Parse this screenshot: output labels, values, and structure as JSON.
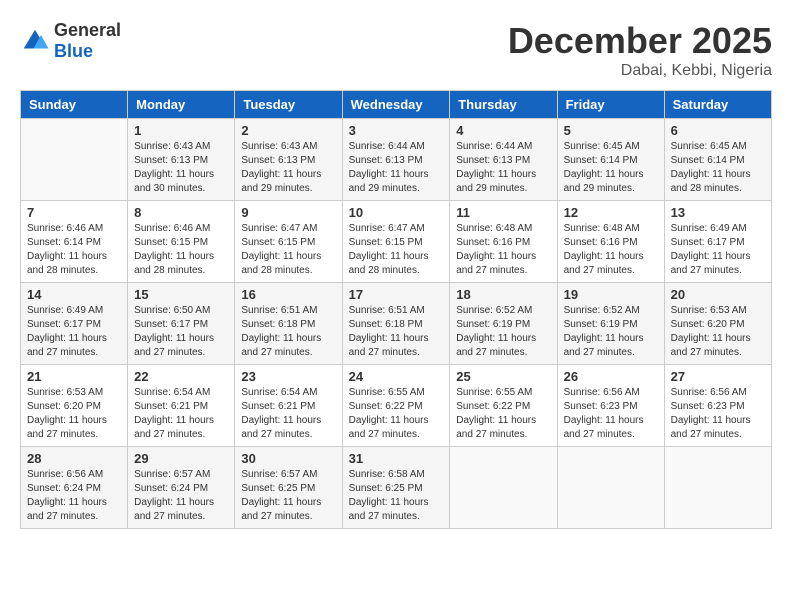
{
  "header": {
    "logo": {
      "general": "General",
      "blue": "Blue"
    },
    "title": "December 2025",
    "location": "Dabai, Kebbi, Nigeria"
  },
  "calendar": {
    "days": [
      "Sunday",
      "Monday",
      "Tuesday",
      "Wednesday",
      "Thursday",
      "Friday",
      "Saturday"
    ],
    "weeks": [
      [
        {
          "num": "",
          "info": ""
        },
        {
          "num": "1",
          "info": "Sunrise: 6:43 AM\nSunset: 6:13 PM\nDaylight: 11 hours\nand 30 minutes."
        },
        {
          "num": "2",
          "info": "Sunrise: 6:43 AM\nSunset: 6:13 PM\nDaylight: 11 hours\nand 29 minutes."
        },
        {
          "num": "3",
          "info": "Sunrise: 6:44 AM\nSunset: 6:13 PM\nDaylight: 11 hours\nand 29 minutes."
        },
        {
          "num": "4",
          "info": "Sunrise: 6:44 AM\nSunset: 6:13 PM\nDaylight: 11 hours\nand 29 minutes."
        },
        {
          "num": "5",
          "info": "Sunrise: 6:45 AM\nSunset: 6:14 PM\nDaylight: 11 hours\nand 29 minutes."
        },
        {
          "num": "6",
          "info": "Sunrise: 6:45 AM\nSunset: 6:14 PM\nDaylight: 11 hours\nand 28 minutes."
        }
      ],
      [
        {
          "num": "7",
          "info": "Sunrise: 6:46 AM\nSunset: 6:14 PM\nDaylight: 11 hours\nand 28 minutes."
        },
        {
          "num": "8",
          "info": "Sunrise: 6:46 AM\nSunset: 6:15 PM\nDaylight: 11 hours\nand 28 minutes."
        },
        {
          "num": "9",
          "info": "Sunrise: 6:47 AM\nSunset: 6:15 PM\nDaylight: 11 hours\nand 28 minutes."
        },
        {
          "num": "10",
          "info": "Sunrise: 6:47 AM\nSunset: 6:15 PM\nDaylight: 11 hours\nand 28 minutes."
        },
        {
          "num": "11",
          "info": "Sunrise: 6:48 AM\nSunset: 6:16 PM\nDaylight: 11 hours\nand 27 minutes."
        },
        {
          "num": "12",
          "info": "Sunrise: 6:48 AM\nSunset: 6:16 PM\nDaylight: 11 hours\nand 27 minutes."
        },
        {
          "num": "13",
          "info": "Sunrise: 6:49 AM\nSunset: 6:17 PM\nDaylight: 11 hours\nand 27 minutes."
        }
      ],
      [
        {
          "num": "14",
          "info": "Sunrise: 6:49 AM\nSunset: 6:17 PM\nDaylight: 11 hours\nand 27 minutes."
        },
        {
          "num": "15",
          "info": "Sunrise: 6:50 AM\nSunset: 6:17 PM\nDaylight: 11 hours\nand 27 minutes."
        },
        {
          "num": "16",
          "info": "Sunrise: 6:51 AM\nSunset: 6:18 PM\nDaylight: 11 hours\nand 27 minutes."
        },
        {
          "num": "17",
          "info": "Sunrise: 6:51 AM\nSunset: 6:18 PM\nDaylight: 11 hours\nand 27 minutes."
        },
        {
          "num": "18",
          "info": "Sunrise: 6:52 AM\nSunset: 6:19 PM\nDaylight: 11 hours\nand 27 minutes."
        },
        {
          "num": "19",
          "info": "Sunrise: 6:52 AM\nSunset: 6:19 PM\nDaylight: 11 hours\nand 27 minutes."
        },
        {
          "num": "20",
          "info": "Sunrise: 6:53 AM\nSunset: 6:20 PM\nDaylight: 11 hours\nand 27 minutes."
        }
      ],
      [
        {
          "num": "21",
          "info": "Sunrise: 6:53 AM\nSunset: 6:20 PM\nDaylight: 11 hours\nand 27 minutes."
        },
        {
          "num": "22",
          "info": "Sunrise: 6:54 AM\nSunset: 6:21 PM\nDaylight: 11 hours\nand 27 minutes."
        },
        {
          "num": "23",
          "info": "Sunrise: 6:54 AM\nSunset: 6:21 PM\nDaylight: 11 hours\nand 27 minutes."
        },
        {
          "num": "24",
          "info": "Sunrise: 6:55 AM\nSunset: 6:22 PM\nDaylight: 11 hours\nand 27 minutes."
        },
        {
          "num": "25",
          "info": "Sunrise: 6:55 AM\nSunset: 6:22 PM\nDaylight: 11 hours\nand 27 minutes."
        },
        {
          "num": "26",
          "info": "Sunrise: 6:56 AM\nSunset: 6:23 PM\nDaylight: 11 hours\nand 27 minutes."
        },
        {
          "num": "27",
          "info": "Sunrise: 6:56 AM\nSunset: 6:23 PM\nDaylight: 11 hours\nand 27 minutes."
        }
      ],
      [
        {
          "num": "28",
          "info": "Sunrise: 6:56 AM\nSunset: 6:24 PM\nDaylight: 11 hours\nand 27 minutes."
        },
        {
          "num": "29",
          "info": "Sunrise: 6:57 AM\nSunset: 6:24 PM\nDaylight: 11 hours\nand 27 minutes."
        },
        {
          "num": "30",
          "info": "Sunrise: 6:57 AM\nSunset: 6:25 PM\nDaylight: 11 hours\nand 27 minutes."
        },
        {
          "num": "31",
          "info": "Sunrise: 6:58 AM\nSunset: 6:25 PM\nDaylight: 11 hours\nand 27 minutes."
        },
        {
          "num": "",
          "info": ""
        },
        {
          "num": "",
          "info": ""
        },
        {
          "num": "",
          "info": ""
        }
      ]
    ]
  }
}
